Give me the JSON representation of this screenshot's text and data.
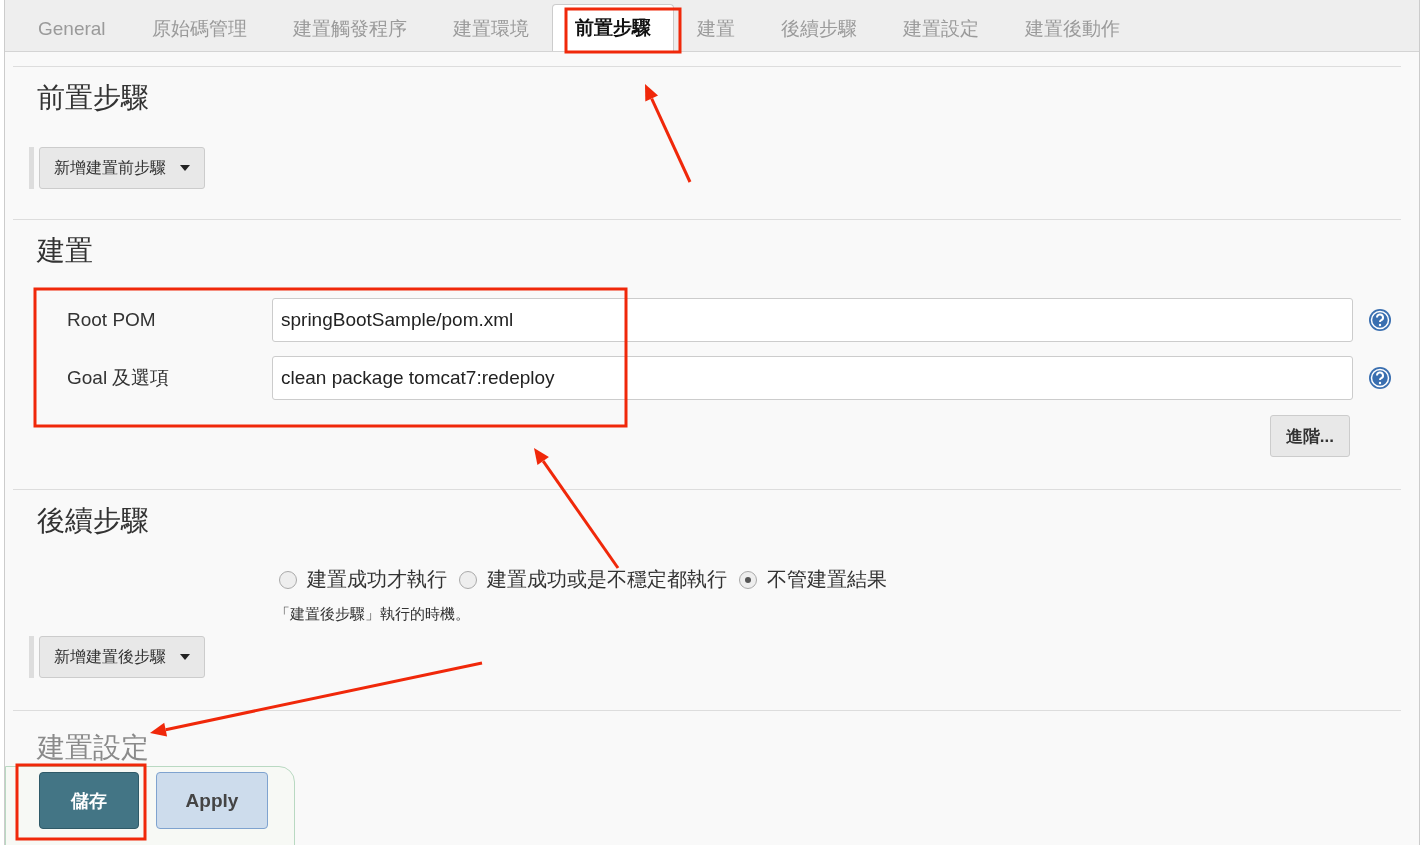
{
  "tabs": [
    {
      "label": "General",
      "selected": false
    },
    {
      "label": "原始碼管理",
      "selected": false
    },
    {
      "label": "建置觸發程序",
      "selected": false
    },
    {
      "label": "建置環境",
      "selected": false
    },
    {
      "label": "前置步驟",
      "selected": true
    },
    {
      "label": "建置",
      "selected": false
    },
    {
      "label": "後續步驟",
      "selected": false
    },
    {
      "label": "建置設定",
      "selected": false
    },
    {
      "label": "建置後動作",
      "selected": false
    }
  ],
  "pre_steps": {
    "heading": "前置步驟",
    "add_button": "新增建置前步驟"
  },
  "build": {
    "heading": "建置",
    "fields": [
      {
        "label": "Root POM",
        "value": "springBootSample/pom.xml"
      },
      {
        "label": "Goal 及選項",
        "value": "clean package tomcat7:redeploy"
      }
    ],
    "advanced_button": "進階..."
  },
  "post_steps": {
    "heading": "後續步驟",
    "options": [
      {
        "label": "建置成功才執行",
        "selected": false
      },
      {
        "label": "建置成功或是不穩定都執行",
        "selected": false
      },
      {
        "label": "不管建置結果",
        "selected": true
      }
    ],
    "hint": "「建置後步驟」執行的時機。",
    "add_button": "新增建置後步驟"
  },
  "settings": {
    "heading": "建置設定"
  },
  "actions": {
    "save": "儲存",
    "apply": "Apply"
  }
}
